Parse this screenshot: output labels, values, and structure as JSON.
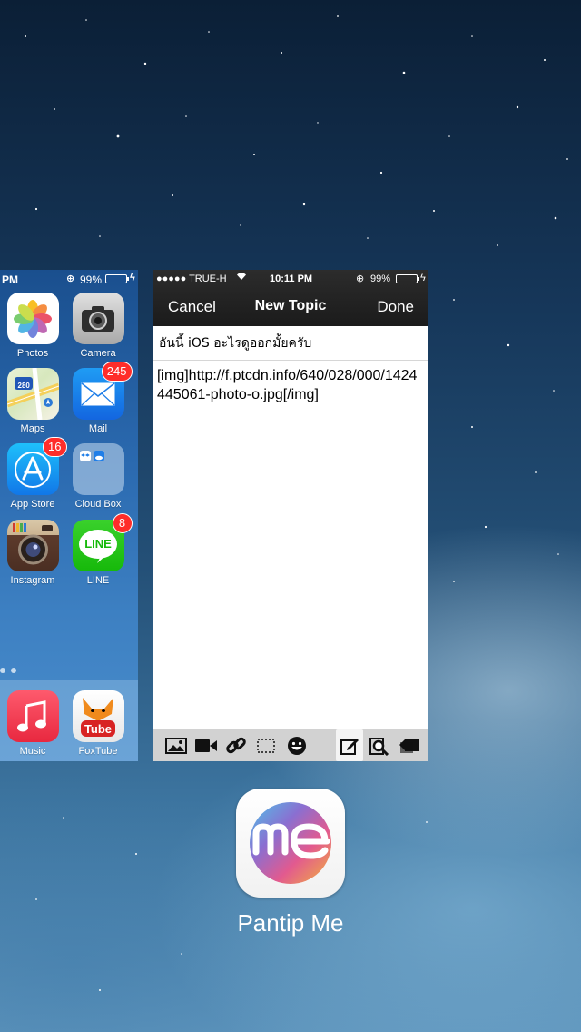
{
  "home_card": {
    "status": {
      "time": "PM",
      "battery": "99%"
    },
    "apps": [
      {
        "name": "Photos",
        "badge": ""
      },
      {
        "name": "Camera",
        "badge": ""
      },
      {
        "name": "Maps",
        "badge": ""
      },
      {
        "name": "Mail",
        "badge": "245"
      },
      {
        "name": "App Store",
        "badge": "16"
      },
      {
        "name": "Cloud Box",
        "badge": ""
      },
      {
        "name": "Instagram",
        "badge": ""
      },
      {
        "name": "LINE",
        "badge": "8"
      }
    ],
    "dock": [
      {
        "name": "Music"
      },
      {
        "name": "FoxTube"
      }
    ],
    "maps_shield": "280",
    "line_icon_text": "LINE",
    "foxtube_icon_text": "Tube"
  },
  "app_card": {
    "status": {
      "carrier": "●●●●● TRUE-H",
      "time": "10:11 PM",
      "battery": "99%"
    },
    "nav": {
      "cancel": "Cancel",
      "title": "New Topic",
      "done": "Done"
    },
    "subject": "อันนี้ iOS อะไรดูออกมั้ยครับ",
    "body": "[img]http://f.ptcdn.info/640/028/000/1424445061-photo-o.jpg[/img]",
    "toolbar": [
      "image-icon",
      "video-icon",
      "link-icon",
      "selection-icon",
      "emoji-icon",
      "edit-icon",
      "preview-icon",
      "tag-icon"
    ]
  },
  "app_switcher": {
    "current_app_name": "Pantip Me",
    "icon_text": "me"
  },
  "colors": {
    "badge": "#ff2d2a",
    "nav_bar": "#1b1b1b",
    "toolbar": "#d2d2d2"
  }
}
